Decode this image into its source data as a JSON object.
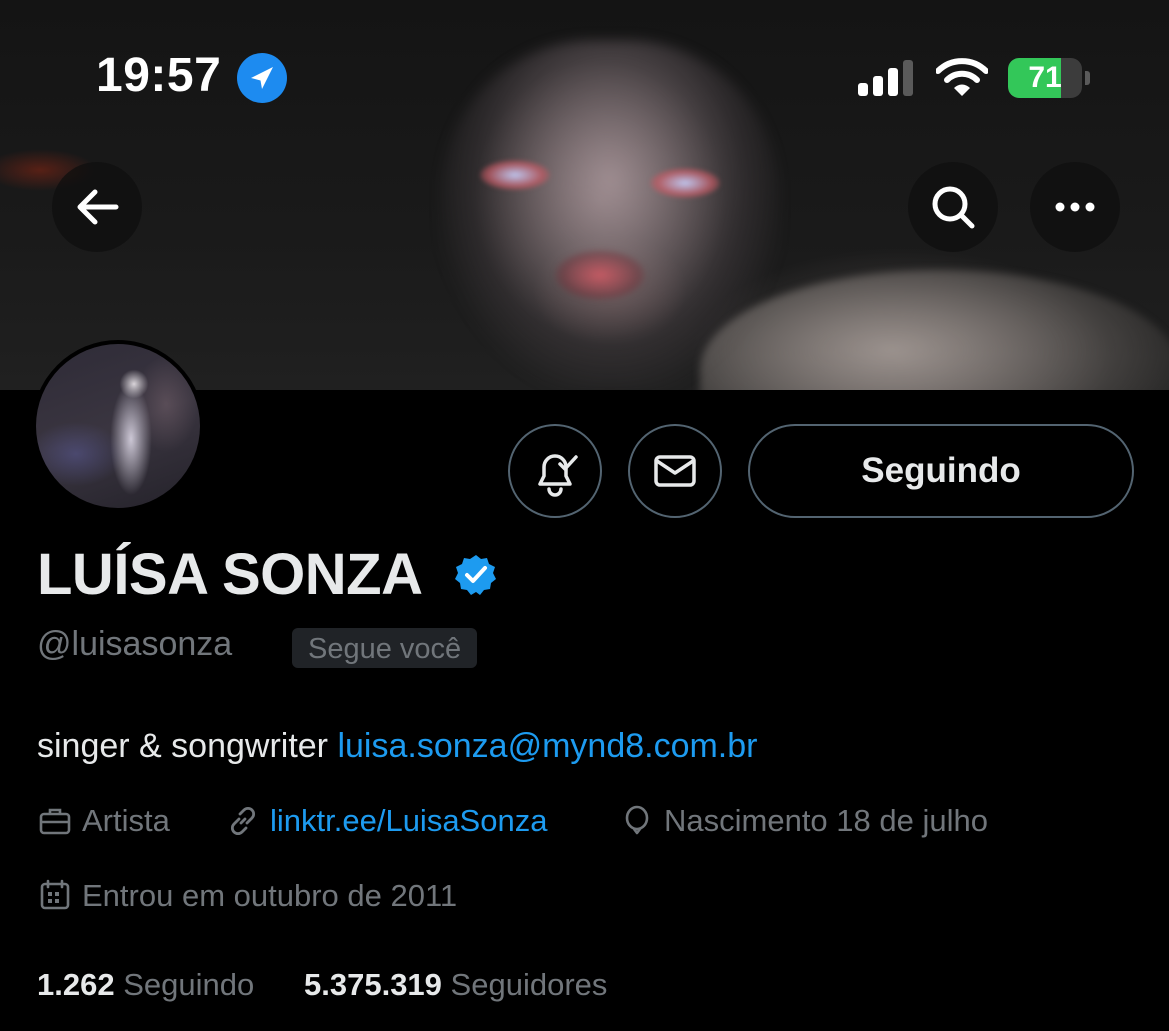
{
  "status_bar": {
    "time": "19:57",
    "battery_level": "71",
    "battery_percent": 71
  },
  "profile": {
    "name": "LUÍSA SONZA",
    "handle": "@luisasonza",
    "follows_you": "Segue você",
    "bio_text": "singer & songwriter",
    "bio_email": "luisa.sonza@mynd8.com.br",
    "category": "Artista",
    "website": "linktr.ee/LuisaSonza",
    "birthday": "Nascimento 18 de julho",
    "joined": "Entrou em outubro de 2011",
    "following_count": "1.262",
    "following_label": "Seguindo",
    "followers_count": "5.375.319",
    "followers_label": "Seguidores"
  },
  "actions": {
    "follow_button": "Seguindo"
  },
  "colors": {
    "background": "#000000",
    "link": "#1d9bf0",
    "verified": "#1d9bf0",
    "muted_text": "#71767b",
    "battery": "#33c759"
  },
  "icons": {
    "back": "arrow-left-icon",
    "search": "search-icon",
    "more": "more-horizontal-icon",
    "notifications": "bell-check-icon",
    "message": "envelope-icon",
    "category": "briefcase-icon",
    "website": "link-icon",
    "birthday": "balloon-icon",
    "joined": "calendar-icon",
    "location": "location-arrow-icon"
  }
}
